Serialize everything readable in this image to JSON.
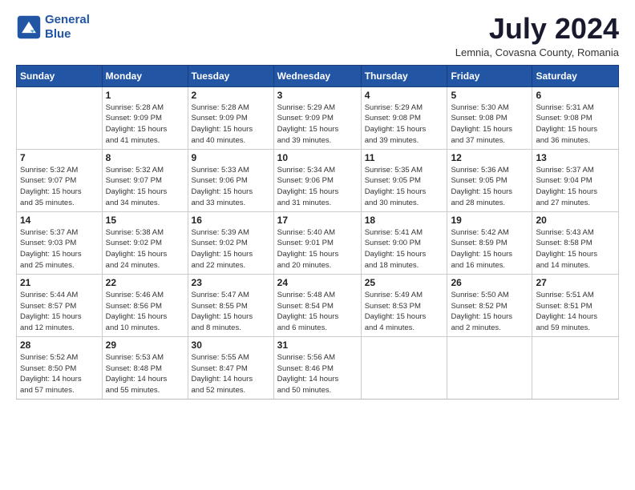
{
  "header": {
    "logo_line1": "General",
    "logo_line2": "Blue",
    "month_year": "July 2024",
    "location": "Lemnia, Covasna County, Romania"
  },
  "weekdays": [
    "Sunday",
    "Monday",
    "Tuesday",
    "Wednesday",
    "Thursday",
    "Friday",
    "Saturday"
  ],
  "weeks": [
    [
      {
        "day": "",
        "info": ""
      },
      {
        "day": "1",
        "info": "Sunrise: 5:28 AM\nSunset: 9:09 PM\nDaylight: 15 hours\nand 41 minutes."
      },
      {
        "day": "2",
        "info": "Sunrise: 5:28 AM\nSunset: 9:09 PM\nDaylight: 15 hours\nand 40 minutes."
      },
      {
        "day": "3",
        "info": "Sunrise: 5:29 AM\nSunset: 9:09 PM\nDaylight: 15 hours\nand 39 minutes."
      },
      {
        "day": "4",
        "info": "Sunrise: 5:29 AM\nSunset: 9:08 PM\nDaylight: 15 hours\nand 39 minutes."
      },
      {
        "day": "5",
        "info": "Sunrise: 5:30 AM\nSunset: 9:08 PM\nDaylight: 15 hours\nand 37 minutes."
      },
      {
        "day": "6",
        "info": "Sunrise: 5:31 AM\nSunset: 9:08 PM\nDaylight: 15 hours\nand 36 minutes."
      }
    ],
    [
      {
        "day": "7",
        "info": "Sunrise: 5:32 AM\nSunset: 9:07 PM\nDaylight: 15 hours\nand 35 minutes."
      },
      {
        "day": "8",
        "info": "Sunrise: 5:32 AM\nSunset: 9:07 PM\nDaylight: 15 hours\nand 34 minutes."
      },
      {
        "day": "9",
        "info": "Sunrise: 5:33 AM\nSunset: 9:06 PM\nDaylight: 15 hours\nand 33 minutes."
      },
      {
        "day": "10",
        "info": "Sunrise: 5:34 AM\nSunset: 9:06 PM\nDaylight: 15 hours\nand 31 minutes."
      },
      {
        "day": "11",
        "info": "Sunrise: 5:35 AM\nSunset: 9:05 PM\nDaylight: 15 hours\nand 30 minutes."
      },
      {
        "day": "12",
        "info": "Sunrise: 5:36 AM\nSunset: 9:05 PM\nDaylight: 15 hours\nand 28 minutes."
      },
      {
        "day": "13",
        "info": "Sunrise: 5:37 AM\nSunset: 9:04 PM\nDaylight: 15 hours\nand 27 minutes."
      }
    ],
    [
      {
        "day": "14",
        "info": "Sunrise: 5:37 AM\nSunset: 9:03 PM\nDaylight: 15 hours\nand 25 minutes."
      },
      {
        "day": "15",
        "info": "Sunrise: 5:38 AM\nSunset: 9:02 PM\nDaylight: 15 hours\nand 24 minutes."
      },
      {
        "day": "16",
        "info": "Sunrise: 5:39 AM\nSunset: 9:02 PM\nDaylight: 15 hours\nand 22 minutes."
      },
      {
        "day": "17",
        "info": "Sunrise: 5:40 AM\nSunset: 9:01 PM\nDaylight: 15 hours\nand 20 minutes."
      },
      {
        "day": "18",
        "info": "Sunrise: 5:41 AM\nSunset: 9:00 PM\nDaylight: 15 hours\nand 18 minutes."
      },
      {
        "day": "19",
        "info": "Sunrise: 5:42 AM\nSunset: 8:59 PM\nDaylight: 15 hours\nand 16 minutes."
      },
      {
        "day": "20",
        "info": "Sunrise: 5:43 AM\nSunset: 8:58 PM\nDaylight: 15 hours\nand 14 minutes."
      }
    ],
    [
      {
        "day": "21",
        "info": "Sunrise: 5:44 AM\nSunset: 8:57 PM\nDaylight: 15 hours\nand 12 minutes."
      },
      {
        "day": "22",
        "info": "Sunrise: 5:46 AM\nSunset: 8:56 PM\nDaylight: 15 hours\nand 10 minutes."
      },
      {
        "day": "23",
        "info": "Sunrise: 5:47 AM\nSunset: 8:55 PM\nDaylight: 15 hours\nand 8 minutes."
      },
      {
        "day": "24",
        "info": "Sunrise: 5:48 AM\nSunset: 8:54 PM\nDaylight: 15 hours\nand 6 minutes."
      },
      {
        "day": "25",
        "info": "Sunrise: 5:49 AM\nSunset: 8:53 PM\nDaylight: 15 hours\nand 4 minutes."
      },
      {
        "day": "26",
        "info": "Sunrise: 5:50 AM\nSunset: 8:52 PM\nDaylight: 15 hours\nand 2 minutes."
      },
      {
        "day": "27",
        "info": "Sunrise: 5:51 AM\nSunset: 8:51 PM\nDaylight: 14 hours\nand 59 minutes."
      }
    ],
    [
      {
        "day": "28",
        "info": "Sunrise: 5:52 AM\nSunset: 8:50 PM\nDaylight: 14 hours\nand 57 minutes."
      },
      {
        "day": "29",
        "info": "Sunrise: 5:53 AM\nSunset: 8:48 PM\nDaylight: 14 hours\nand 55 minutes."
      },
      {
        "day": "30",
        "info": "Sunrise: 5:55 AM\nSunset: 8:47 PM\nDaylight: 14 hours\nand 52 minutes."
      },
      {
        "day": "31",
        "info": "Sunrise: 5:56 AM\nSunset: 8:46 PM\nDaylight: 14 hours\nand 50 minutes."
      },
      {
        "day": "",
        "info": ""
      },
      {
        "day": "",
        "info": ""
      },
      {
        "day": "",
        "info": ""
      }
    ]
  ]
}
